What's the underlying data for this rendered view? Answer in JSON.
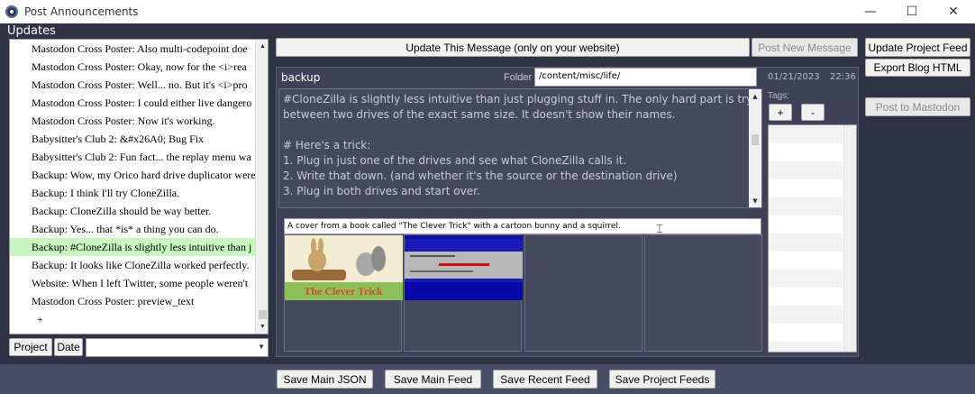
{
  "window": {
    "title": "Post Announcements",
    "min_glyph": "—",
    "max_glyph": "☐",
    "close_glyph": "✕"
  },
  "updates_label": "Updates",
  "updates": [
    "Mastodon Cross Poster:  Also multi-codepoint doe",
    "Mastodon Cross Poster:  Okay, now for the <i>rea",
    "Mastodon Cross Poster:  Well... no. But it's <i>pro",
    "Mastodon Cross Poster:  I could either live dangero",
    "Mastodon Cross Poster:  Now it's working.",
    "Babysitter's Club 2:  &#x26A0; Bug Fix",
    "Babysitter's Club 2:  Fun fact... the replay menu wa",
    "Backup:  Wow, my Orico hard drive duplicator were",
    "Backup:  I think I'll try CloneZilla.",
    "Backup:  CloneZilla should be way better.",
    "Backup:  Yes... that *is* a thing you can do.",
    "Backup:  #CloneZilla is slightly less intuitive than j",
    "Backup:  It looks like CloneZilla worked perfectly.",
    "Website:  When I left Twitter, some people weren't",
    "Mastodon Cross Poster:  preview_text",
    "+"
  ],
  "selected_index": 11,
  "sort_buttons": {
    "project": "Project",
    "date": "Date"
  },
  "update_message_button": "Update This Message  (only on your website)",
  "post_new_message_button": "Post New Message",
  "update_project_feed_button": "Update Project Feed",
  "export_blog_html_button": "Export Blog HTML",
  "post_to_mastodon_button": "Post to Mastodon",
  "editor": {
    "project_name": "backup",
    "folder_label": "Folder",
    "folder_value": "/content/misc/life/",
    "date": "01/21/2023",
    "time": "22:36",
    "body_lines": [
      "#CloneZilla is slightly less intuitive than just plugging stuff in. The only hard part is trying pick",
      "between two drives of the exact same size. It doesn't show their names.",
      "",
      "# Here's a trick:",
      "1. Plug in just one of the drives and see what CloneZilla calls it.",
      "2. Write that down. (and whether it's the source or the destination drive)",
      "3. Plug in both drives and start over."
    ],
    "caption": "A cover from a book called \"The Clever Trick\" with a cartoon bunny and a squirrel.",
    "book_cover_text": "The Clever Trick"
  },
  "tags": {
    "label": "Tags:",
    "add": "+",
    "remove": "-"
  },
  "save_buttons": {
    "main_json": "Save Main JSON",
    "main_feed": "Save Main Feed",
    "recent_feed": "Save Recent Feed",
    "project_feeds": "Save Project Feeds"
  },
  "colors": {
    "background": "#2f3244",
    "panel": "#3e4157",
    "selected_row": "#c9f5c1",
    "body_text": "#c8cada"
  }
}
